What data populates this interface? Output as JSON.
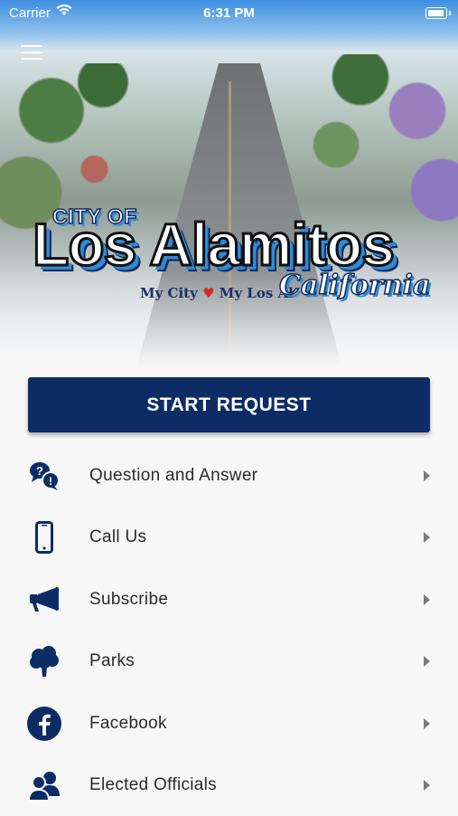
{
  "status_bar": {
    "carrier": "Carrier",
    "time": "6:31 PM"
  },
  "logo": {
    "city_of": "CITY OF",
    "city_name": "Los Alamitos",
    "tagline_left": "My City",
    "tagline_right": "My Los Al",
    "state": "California"
  },
  "start_button": {
    "label": "START REQUEST"
  },
  "menu_items": [
    {
      "label": "Question and Answer",
      "icon": "question-answer-icon"
    },
    {
      "label": "Call Us",
      "icon": "phone-icon"
    },
    {
      "label": "Subscribe",
      "icon": "megaphone-icon"
    },
    {
      "label": "Parks",
      "icon": "tree-icon"
    },
    {
      "label": "Facebook",
      "icon": "facebook-icon"
    },
    {
      "label": "Elected Officials",
      "icon": "officials-icon"
    }
  ],
  "colors": {
    "primary": "#0d2c66",
    "accent": "#2f8ad8",
    "heart": "#d22b2b"
  }
}
